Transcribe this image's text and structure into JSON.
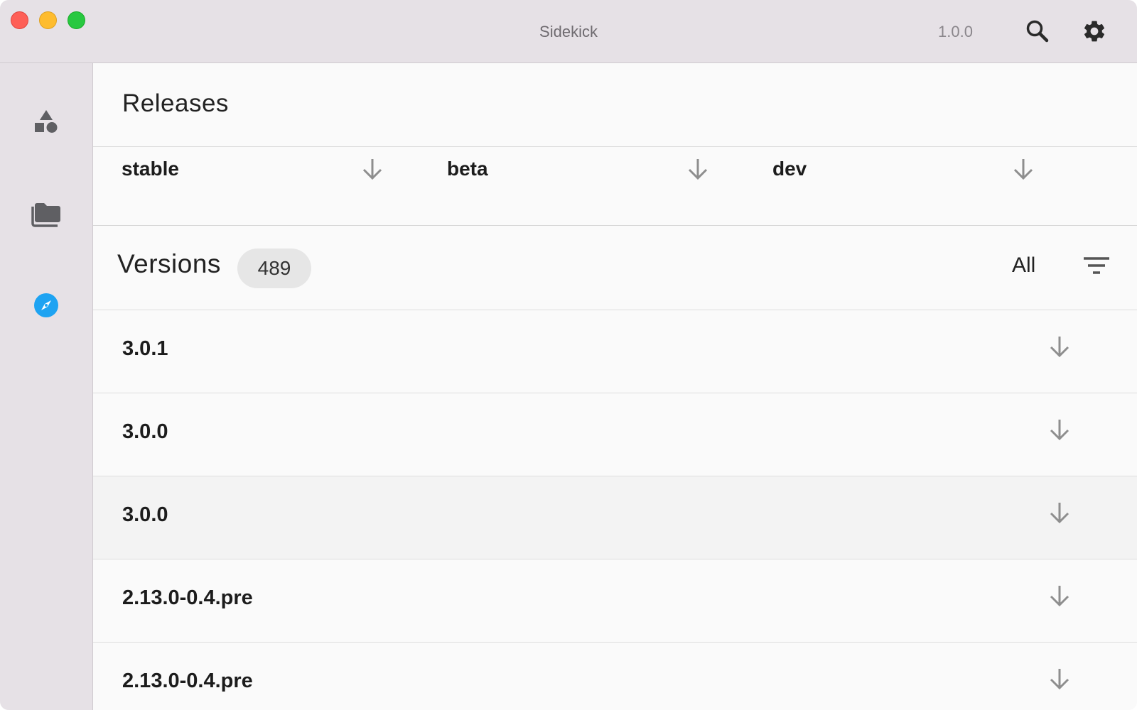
{
  "window": {
    "title": "Sidekick",
    "app_version": "1.0.0",
    "icons": {
      "search": "search-icon",
      "settings": "gear-icon"
    }
  },
  "sidebar": {
    "items": [
      {
        "name": "shapes-icon",
        "active": false
      },
      {
        "name": "folders-icon",
        "active": false
      },
      {
        "name": "compass-icon",
        "active": true,
        "color": "#1ea3f2"
      }
    ]
  },
  "releases": {
    "title": "Releases",
    "channels": [
      {
        "label": "stable",
        "icon": "download-arrow-icon"
      },
      {
        "label": "beta",
        "icon": "download-arrow-icon"
      },
      {
        "label": "dev",
        "icon": "download-arrow-icon"
      }
    ]
  },
  "versions": {
    "title": "Versions",
    "count": "489",
    "filter_label": "All",
    "filter_icon": "filter-icon",
    "items": [
      {
        "name": "3.0.1",
        "highlighted": false
      },
      {
        "name": "3.0.0",
        "highlighted": false
      },
      {
        "name": "3.0.0",
        "highlighted": true
      },
      {
        "name": "2.13.0-0.4.pre",
        "highlighted": false
      },
      {
        "name": "2.13.0-0.4.pre",
        "highlighted": false
      }
    ]
  }
}
